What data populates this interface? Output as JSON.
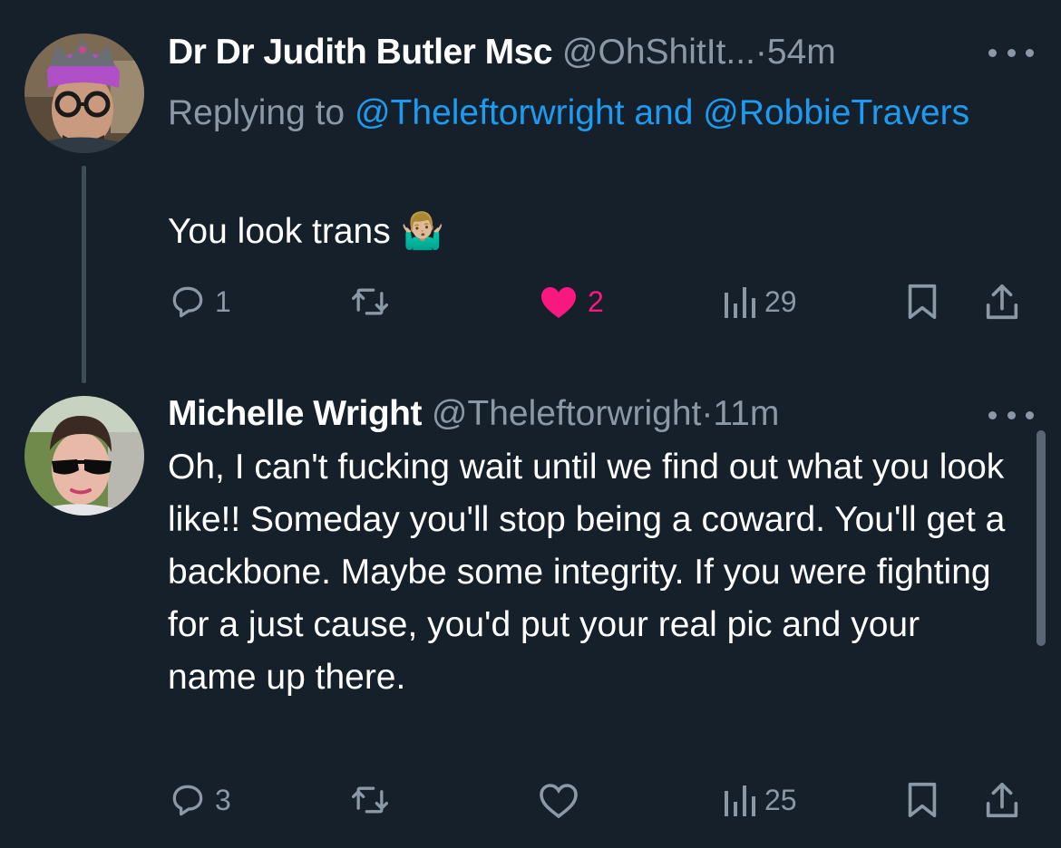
{
  "tweets": [
    {
      "author_name": "Dr Dr Judith Butler Msc",
      "handle": "@OhShitIt...",
      "separator": "·",
      "time": "54m",
      "replying_prefix": "Replying to",
      "replying_to": "@Theleftorwright and @RobbieTravers",
      "text": "You look trans 🤷🏼‍♂️",
      "reply_count": "1",
      "retweet_count": "",
      "like_count": "2",
      "liked": true,
      "view_count": "29",
      "avatar_icon": "avatar-crown-glasses"
    },
    {
      "author_name": "Michelle Wright",
      "handle": "@Theleftorwright",
      "separator": "·",
      "time": "11m",
      "text": "Oh, I can't fucking wait until we find out what you look like!! Someday you'll stop being a coward. You'll get a backbone. Maybe some integrity. If you were fighting for a just cause, you'd put your real pic and your name up there.",
      "reply_count": "3",
      "retweet_count": "",
      "like_count": "",
      "liked": false,
      "view_count": "25",
      "avatar_icon": "avatar-sunglasses"
    }
  ],
  "colors": {
    "background": "#15202b",
    "text": "#ffffff",
    "muted": "#8b98a5",
    "link": "#1d9bf0",
    "like": "#f91880"
  },
  "icons": [
    "reply-icon",
    "retweet-icon",
    "heart-icon",
    "views-icon",
    "bookmark-icon",
    "share-icon",
    "more-icon"
  ]
}
